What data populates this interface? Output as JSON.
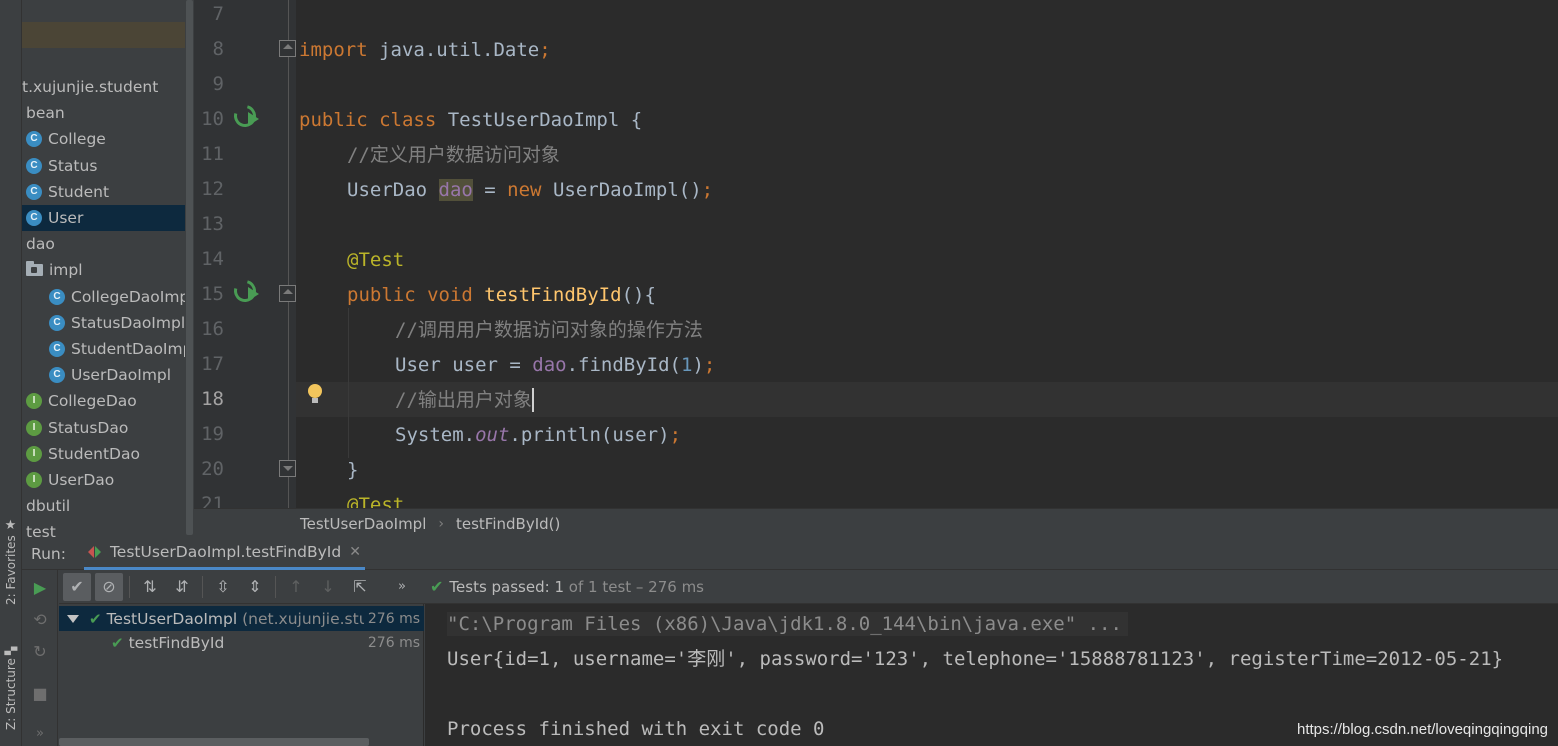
{
  "tool_strip": {
    "favorites_label": "2: Favorites",
    "structure_label": "Z: Structure"
  },
  "project_tree": {
    "rows": [
      {
        "label": "t.xujunjie.student",
        "kind": "package"
      },
      {
        "label": "bean",
        "kind": "package"
      },
      {
        "label": "College",
        "kind": "class"
      },
      {
        "label": "Status",
        "kind": "class"
      },
      {
        "label": "Student",
        "kind": "class"
      },
      {
        "label": "User",
        "kind": "class"
      },
      {
        "label": "dao",
        "kind": "package"
      },
      {
        "label": "impl",
        "kind": "folder"
      },
      {
        "label": "CollegeDaoImpl",
        "kind": "class"
      },
      {
        "label": "StatusDaoImpl",
        "kind": "class"
      },
      {
        "label": "StudentDaoImpl",
        "kind": "class"
      },
      {
        "label": "UserDaoImpl",
        "kind": "class"
      },
      {
        "label": "CollegeDao",
        "kind": "interface"
      },
      {
        "label": "StatusDao",
        "kind": "interface"
      },
      {
        "label": "StudentDao",
        "kind": "interface"
      },
      {
        "label": "UserDao",
        "kind": "interface"
      },
      {
        "label": "dbutil",
        "kind": "package"
      },
      {
        "label": "test",
        "kind": "package"
      }
    ],
    "selected": "User",
    "icon_letters": {
      "class": "C",
      "interface": "I"
    }
  },
  "editor": {
    "line_numbers": [
      "7",
      "8",
      "9",
      "10",
      "11",
      "12",
      "13",
      "14",
      "15",
      "16",
      "17",
      "18",
      "19",
      "20",
      "21"
    ],
    "current_line": "18",
    "code": {
      "l8_import": "import",
      "l8_rest": " java.util.Date",
      "l8_semi": ";",
      "l10_public": "public",
      "l10_class": " class",
      "l10_name": " TestUserDaoImpl ",
      "l10_brace": "{",
      "l11_comment": "//定义用户数据访问对象",
      "l12_type": "UserDao ",
      "l12_field": "dao",
      "l12_eq": " = ",
      "l12_new": "new",
      "l12_ctor": " UserDaoImpl()",
      "l12_semi": ";",
      "l14_annot": "@Test",
      "l15_public": "public",
      "l15_void": " void",
      "l15_method": " testFindById",
      "l15_rest": "(){",
      "l16_comment": "//调用用户数据访问对象的操作方法",
      "l17_start": "User user = ",
      "l17_field": "dao",
      "l17_call": ".findById(",
      "l17_num": "1",
      "l17_close": ")",
      "l17_semi": ";",
      "l18_comment": "//输出用户对象",
      "l19_start": "System.",
      "l19_out": "out",
      "l19_rest": ".println(user)",
      "l19_semi": ";",
      "l20_close": "}",
      "l21_annot": "@Test"
    }
  },
  "breadcrumb": {
    "class": "TestUserDaoImpl",
    "method": "testFindById()"
  },
  "run_panel": {
    "label": "Run:",
    "tab_title": "TestUserDaoImpl.testFindById",
    "status_prefix": "Tests passed:",
    "status_count": "1",
    "status_suffix": "of 1 test – 276 ms",
    "tree": [
      {
        "name": "TestUserDaoImpl",
        "pkg": "(net.xujunjie.stude",
        "time": "276 ms"
      },
      {
        "name": "testFindById",
        "time": "276 ms"
      }
    ],
    "console": [
      "\"C:\\Program Files (x86)\\Java\\jdk1.8.0_144\\bin\\java.exe\" ...",
      "User{id=1, username='李刚', password='123', telephone='15888781123', registerTime=2012-05-21}",
      "",
      "Process finished with exit code 0"
    ],
    "watermark": "https://blog.csdn.net/loveqingqingqing"
  },
  "colors": {
    "keyword": "#cc7832",
    "comment": "#808080",
    "annotation": "#bbb529",
    "method": "#ffc66d",
    "field": "#9876aa",
    "number": "#6897bb",
    "pass_green": "#499c54",
    "selection": "#0d293e"
  }
}
